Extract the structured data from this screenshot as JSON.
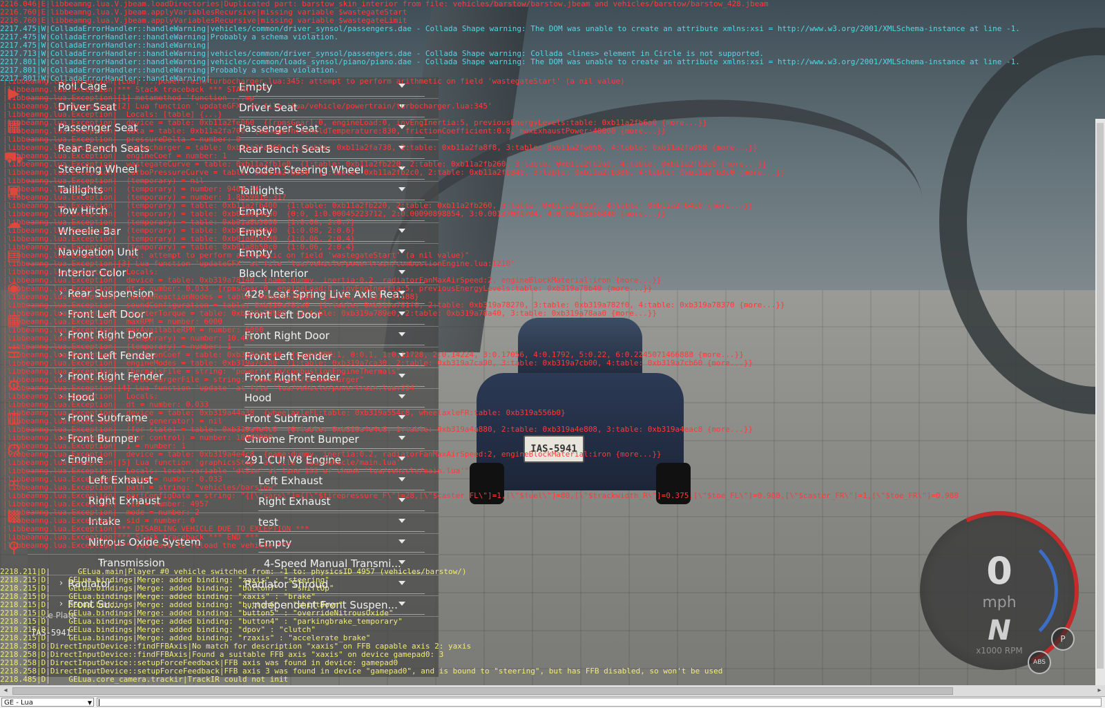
{
  "console": {
    "lines": [
      {
        "lvl": "E",
        "text": "2216.046|E|libbeamng.lua.V.jbeam.loadDirectories|Duplicated part: barstow_skin_interior from file: vehicles/barstow/barstow.jbeam and vehicles/barstow/barstow_428.jbeam"
      },
      {
        "lvl": "E",
        "text": "2216.760|E|libbeamng.lua.V.jbeam.applyVariablesRecursive|missing variable $wastegateStart"
      },
      {
        "lvl": "E",
        "text": "2216.760|E|libbeamng.lua.V.jbeam.applyVariablesRecursive|missing variable $wastegateLimit"
      },
      {
        "lvl": "W",
        "text": "2217.475|W|ColladaErrorHandler::handleWarning|vehicles/common/driver_synsol/passengers.dae - Collada Shape warning: The DOM was unable to create an attribute xmlns:xsi = http://www.w3.org/2001/XMLSchema-instance at line -1."
      },
      {
        "lvl": "W",
        "text": "2217.475|W|ColladaErrorHandler::handleWarning|Probably a schema violation."
      },
      {
        "lvl": "W",
        "text": "2217.475|W|ColladaErrorHandler::handleWarning|"
      },
      {
        "lvl": "W",
        "text": "2217.713|W|ColladaErrorHandler::handleWarning|vehicles/common/driver_synsol/passengers.dae - Collada Shape warning: Collada <lines> element in Circle is not supported."
      },
      {
        "lvl": "W",
        "text": "2217.801|W|ColladaErrorHandler::handleWarning|vehicles/common/loads_synsol/piano/piano.dae - Collada Shape warning: The DOM was unable to create an attribute xmlns:xsi = http://www.w3.org/2001/XMLSchema-instance at line -1."
      },
      {
        "lvl": "W",
        "text": "2217.801|W|ColladaErrorHandler::handleWarning|Probably a schema violation."
      },
      {
        "lvl": "W",
        "text": "2217.801|W|ColladaErrorHandler::handleWarning|"
      }
    ],
    "red_overlay": [
      "|libbeamng.lua.Exception|[Lua] ...powertrain/turbocharger.lua:345: attempt to perform arithmetic on field 'wastegateStart' (a nil value)",
      "|libbeamng.lua.Exception|*** Stack traceback *** START ***",
      "|libbeamng.lua.Exception|[1] metamethod 'function ...mp'",
      "|libbeamng.lua.Exception|[2] Lua function 'updateGFX' at file 'lua/vehicle/powertrain/turbocharger.lua:345'",
      "|libbeamng.lua.Exception|  Locals: [table] {...}",
      "|libbeamng.lua.Exception|  device = table: 0xb11a2fe060  {[rpmsGear]:0, engineLoad:0, invEngInertia:5, previousEnergyLevels:table: 0xb11a2fb6a0 {more...}}",
      "|libbeamng.lua.Exception|  data = table: 0xb11a2fa700  {damageThresholdTemperature:830, frictionCoefficient:0.8, maxExhaustPower:40000 {more...}}",
      "|libbeamng.lua.Exception|  pressureDelta = number: 0",
      "|libbeamng.lua.Exception|  turbocharger = table: 0xb11a2fa860  {1:table: 0xb11a2fa738, 2:table: 0xb11a2fa8f8, 3:table: 0xb11a2fa668, 4:table: 0xb11a2fa988 {more...}}",
      "|libbeamng.lua.Exception|  engineCoef = number: 1",
      "|libbeamng.lua.Exception|  wastegateCurve = table: 0xb11a2fb1e0  {1:table: 0xb11a2fb220, 2:table: 0xb11a2fb260, 3:table: 0xb11a2fb2a0, 4:table: 0xb11a2fb2e0 {more...}}",
      "|libbeamng.lua.Exception|  turboPressureCurve = table: 0xb11a2fb280  {1:table: 0xb11a2fb2c0, 2:table: 0xb11a2fb340, 3:table: 0xb11a2fb380, 4:table: 0xb11a2fb3c0 {more...}}",
      "|libbeamng.lua.Exception|  (temporary) = nil",
      "|libbeamng.lua.Exception|  (temporary) = number: 9404.74",
      "|libbeamng.lua.Exception|  (temporary) = number: 1.885981e-317",
      "|libbeamng.lua.Exception|  (temporary) = table: 0xb11a2fb400  {1:table: 0xb11a2fb220, 2:table: 0xb11a2fb260, 3:table: 0xb11a2fb2a0, 4:table: 0xb11a2fb4e0 {more...}}",
      "|libbeamng.lua.Exception|  (temporary) = table: 0xb01a8b4ea0  {0:0, 1:0.00045223712, 2:0.00090898854, 3:0.00137009704, 4:0.00183566848 {more...}}",
      "|libbeamng.lua.Exception|  (temporary) = table: 0xb01a8b5000  {1:0.06, 2:0.7}",
      "|libbeamng.lua.Exception|  (temporary) = table: 0xb01a8b5040  {1:0.08, 2:0.6}",
      "|libbeamng.lua.Exception|  (temporary) = table: 0xb01a8b5080  {1:0.06, 2:0.4}",
      "|libbeamng.lua.Exception|  (temporary) = table: 0xb01a8b50c0  {1:0.06, 2:0.4}",
      "|libbeamng.lua.Exception|  [C]: attempt to perform arithmetic on field 'wastegateStart' (a nil value)\"",
      "|libbeamng.lua.Exception|[3] Lua function 'updateGFX' at file 'lua/vehicle/powertrain/combustionEngine.lua:1210'",
      "|libbeamng.lua.Exception|  Locals:",
      "|libbeamng.lua.Exception|  device = table: 0xb319a78140  {name:dummy, inertia:0.2, radiatorFanMaxAirSpeed:2, engineBlockMaterial:iron {more...}}",
      "|libbeamng.lua.Exception|  dt = number: 0.033  {rpmsGear:0, engineLoad:0, invEngInertia:5, previousEnergyLevels:table: 0xb319a78b40 {more...}}",
      "|libbeamng.lua.Exception|  torqueReactionNodes = table: 0xb319a78120  {1:194, 2:191, 3:188}",
      "|libbeamng.lua.Exception|  soundConfiguration = table: 0xb319a781a0  {1:table: 0xb319a781f0, 2:table: 0xb319a78270, 3:table: 0xb319a782f0, 4:table: 0xb319a78370 {more...}}",
      "|libbeamng.lua.Exception|  starterTorque = table: 0xb319a78980  {1:table: 0xb319a789e0, 2:table: 0xb319a78a40, 3:table: 0xb319a78aa0 {more...}}",
      "|libbeamng.lua.Exception|  maxRPM = number: 6000",
      "|libbeamng.lua.Exception|  maxAvailableRPM = number: 6000",
      "|libbeamng.lua.Exception|  (temporary) = number: 10.471",
      "|libbeamng.lua.Exception|  (temporary) = number: 1",
      "|libbeamng.lua.Exception|  frictionCoef = table: 0xb319a78e40  {tightRPM:1, 0:0.1, 1:0.11728, 2:0.14224, 3:0.17056, 4:0.1792, 5:0.22, 6:0.2245071466888 {more...}}",
      "|libbeamng.lua.Exception|  engineModes = table: 0xb319a7c500  {1:table: 0xb319a7ca30, 2:table: 0xb319a7ca90, 3:table: 0xb319a7cb00, 4:table: 0xb319a7cb60 {more...}}",
      "|libbeamng.lua.Exception|  thermalsFile = string: \"powertrain/combustionEngineThermals\"",
      "|libbeamng.lua.Exception|  turbochargerFile = string: \"powertrain/turbocharger\"",
      "|libbeamng.lua.Exception|[4] Lua function 'update' at file 'lua/vehicle/powertrain.lua:334'",
      "|libbeamng.lua.Exception|  Locals:",
      "|libbeamng.lua.Exception|  dt = number: 0.033",
      "|libbeamng.lua.Exception|  device = table: 0xb319a44a38  {wheelaxleFL:table: 0xb319a554c8, wheelaxleFR:table: 0xb319a556b0}",
      "|libbeamng.lua.Exception|  (for generator) = nil",
      "|libbeamng.lua.Exception|  (for state) = table: 0xb319a4e4c0  {0:table: 0xb319a4e4c8, 1:table: 0xb319a4a880, 2:table: 0xb319a4e808, 3:table: 0xb319a4eac8 {more...}}",
      "|libbeamng.lua.Exception|  (for control) = number: 10000000",
      "|libbeamng.lua.Exception|  i = number: 1",
      "|libbeamng.lua.Exception|  device = table: 0xb319a4e4c8  {name:dummy, inertia:0.2, radiatorFanMaxAirSpeed:2, engineBlockMaterial:iron {more...}}",
      "|libbeamng.lua.Exception|[5] Lua function 'graphicsStep' at file 'lua/vehicle/main.lua'",
      "|libbeamng.lua.Exception|  Locals: local variable 'dtSim' at line 155 of chunk 'lua/vehicle/main.lua'\"",
      "|libbeamng.lua.Exception|  dtSim = number: 0.033",
      "|libbeamng.lua.Exception|  path = string: \"vehicles/barstow\"",
      "|libbeamng.lua.Exception|  partConfigData = string: \"{[\\\"vars\\\"]={[\\\"$tirepressure_F\\\"]=28,[\\\"$caster_FL\\\"]=1,[\\\"$fuel\\\"]=80,[\\\"$trackwidth_R\\\"]=0.375,[\\\"$toe_FL\\\"]=0.988,[\\\"$caster_FR\\\"]=1,[\\\"$toe_FR\\\"]=0.988",
      "|libbeamng.lua.Exception|  vid = number: 4957",
      "|libbeamng.lua.Exception|  mode = number: 2",
      "|libbeamng.lua.Exception|  sid = number: 0",
      "|libbeamng.lua.Exception|*** DISABLING VEHICLE DUE TO EXCEPTION ***",
      "|libbeamng.lua.Exception|*** Stack traceback *** END ***",
      "|libbeamng.lua.Exception|*** you have to reload the vehicle ***"
    ],
    "debug_lines": [
      "2218.211|D|      GELua.main|Player #0 vehicle switched from: -1 to: physicsID 4957 (vehicles/barstow/)",
      "2218.215|D|    GELua.bindings|Merge: added binding: \"zaxis\" : \"steering\"",
      "2218.215|D|    GELua.bindings|Merge: added binding: \"button7\" : \"shiftUp\"",
      "2218.215|D|    GELua.bindings|Merge: added binding: \"xaxis\" : \"brake\"",
      "2218.215|D|    GELua.bindings|Merge: added binding: \"button6\" : \"shiftDown\"",
      "2218.215|D|    GELua.bindings|Merge: added binding: \"button5\" : \"overrideNitrousOxide\"",
      "2218.215|D|    GELua.bindings|Merge: added binding: \"button4\" : \"parkingbrake_temporary\"",
      "2218.215|D|    GELua.bindings|Merge: added binding: \"dpov\" : \"clutch\"",
      "2218.215|D|    GELua.bindings|Merge: added binding: \"rzaxis\" : \"accelerate_brake\"",
      "2218.258|D|DirectInputDevice::findFFBAxis|No match for description \"xaxis\" on FFB capable axis 2: yaxis",
      "2218.258|D|DirectInputDevice::findFFBAxis|Found a suitable FFB axis \"xaxis\" on device gamepad0: 3",
      "2218.258|D|DirectInputDevice::setupForceFeedback|FFB axis was found in device: gamepad0",
      "2218.258|D|DirectInputDevice::setupForceFeedback|FFB axis 3 was found in device \"gamepad0\", and is bound to \"steering\", but has FFB disabled, so won't be used",
      "2218.485|D|    GELua.core_camera.trackir|TrackIR could not init"
    ]
  },
  "config_panel": {
    "rows": [
      {
        "name": "roll-cage",
        "label": "Roll Cage",
        "value": "Empty",
        "indent": 0,
        "expander": ""
      },
      {
        "name": "driver-seat",
        "label": "Driver Seat",
        "value": "Driver Seat",
        "indent": 0,
        "expander": ""
      },
      {
        "name": "passenger-seat",
        "label": "Passenger Seat",
        "value": "Passenger Seat",
        "indent": 0,
        "expander": ""
      },
      {
        "name": "rear-bench-seats",
        "label": "Rear Bench Seats",
        "value": "Rear Bench Seats",
        "indent": 0,
        "expander": ""
      },
      {
        "name": "steering-wheel",
        "label": "Steering Wheel",
        "value": "Wooden Steering Wheel",
        "indent": 0,
        "expander": ""
      },
      {
        "name": "taillights",
        "label": "Taillights",
        "value": "Taillights",
        "indent": 0,
        "expander": ""
      },
      {
        "name": "tow-hitch",
        "label": "Tow Hitch",
        "value": "Empty",
        "indent": 0,
        "expander": ""
      },
      {
        "name": "wheelie-bar",
        "label": "Wheelie Bar",
        "value": "Empty",
        "indent": 0,
        "expander": ""
      },
      {
        "name": "navigation-unit",
        "label": "Navigation Unit",
        "value": "Empty",
        "indent": 0,
        "expander": ""
      },
      {
        "name": "interior-color",
        "label": "Interior Color",
        "value": "Black Interior",
        "indent": 0,
        "expander": ""
      },
      {
        "name": "rear-suspension",
        "label": "Rear Suspension",
        "value": "428 Leaf Spring Live Axle Rea...",
        "indent": 1,
        "expander": "›"
      },
      {
        "name": "front-left-door",
        "label": "Front Left Door",
        "value": "Front Left Door",
        "indent": 1,
        "expander": "›"
      },
      {
        "name": "front-right-door",
        "label": "Front Right Door",
        "value": "Front Right Door",
        "indent": 1,
        "expander": "›"
      },
      {
        "name": "front-left-fender",
        "label": "Front Left Fender",
        "value": "Front Left Fender",
        "indent": 1,
        "expander": "›"
      },
      {
        "name": "front-right-fender",
        "label": "Front Right Fender",
        "value": "Front Right Fender",
        "indent": 1,
        "expander": "›"
      },
      {
        "name": "hood",
        "label": "Hood",
        "value": "Hood",
        "indent": 1,
        "expander": "›"
      },
      {
        "name": "front-subframe",
        "label": "Front Subframe",
        "value": "Front Subframe",
        "indent": 1,
        "expander": "⌄"
      },
      {
        "name": "front-bumper",
        "label": "Front Bumper",
        "value": "Chrome Front Bumper",
        "indent": 2,
        "expander": "›"
      },
      {
        "name": "engine",
        "label": "Engine",
        "value": "291 CUI V8 Engine",
        "indent": 2,
        "expander": "⌄"
      },
      {
        "name": "left-exhaust",
        "label": "Left Exhaust",
        "value": "Left Exhaust",
        "indent": 3,
        "expander": ""
      },
      {
        "name": "right-exhaust",
        "label": "Right Exhaust",
        "value": "Right Exhaust",
        "indent": 3,
        "expander": ""
      },
      {
        "name": "intake",
        "label": "Intake",
        "value": "test",
        "indent": 3,
        "expander": ""
      },
      {
        "name": "nitrous-oxide-system",
        "label": "Nitrous Oxide System",
        "value": "Empty",
        "indent": 3,
        "expander": ""
      },
      {
        "name": "transmission",
        "label": "Transmission",
        "value": "4-Speed Manual Transmi...",
        "indent": 4,
        "expander": "›"
      },
      {
        "name": "radiator",
        "label": "Radiator",
        "value": "Radiator Shroud",
        "indent": 2,
        "expander": "›"
      },
      {
        "name": "front-suspension",
        "label": "Front Su...",
        "value": "...ndependent Front Suspen...",
        "indent": 2,
        "expander": "›"
      }
    ],
    "license_plate_label": "...e Plate",
    "license_plate_value": "IAS-5941"
  },
  "scene": {
    "plate_text": "IAS-5941"
  },
  "hud": {
    "speed": "0",
    "unit": "mph",
    "gear": "N",
    "rpm_label": "x1000 RPM",
    "badge_p": "P",
    "badge_abs": "ABS"
  },
  "command_bar": {
    "context": "GE - Lua",
    "input_value": ""
  },
  "colors": {
    "warning": "#55d6e6",
    "error": "#ff3a3a",
    "debug": "#f2ec7a",
    "rail_icon": "#d94a3c"
  },
  "rail_icons": [
    "play-icon",
    "film-icon",
    "car-icon",
    "vehicle-config-icon",
    "cloud-icon",
    "grid-icon",
    "camera-icon",
    "calendar-icon",
    "sliders-icon",
    "gear-icon",
    "bar-chart-icon",
    "headset-icon",
    "link-icon"
  ]
}
